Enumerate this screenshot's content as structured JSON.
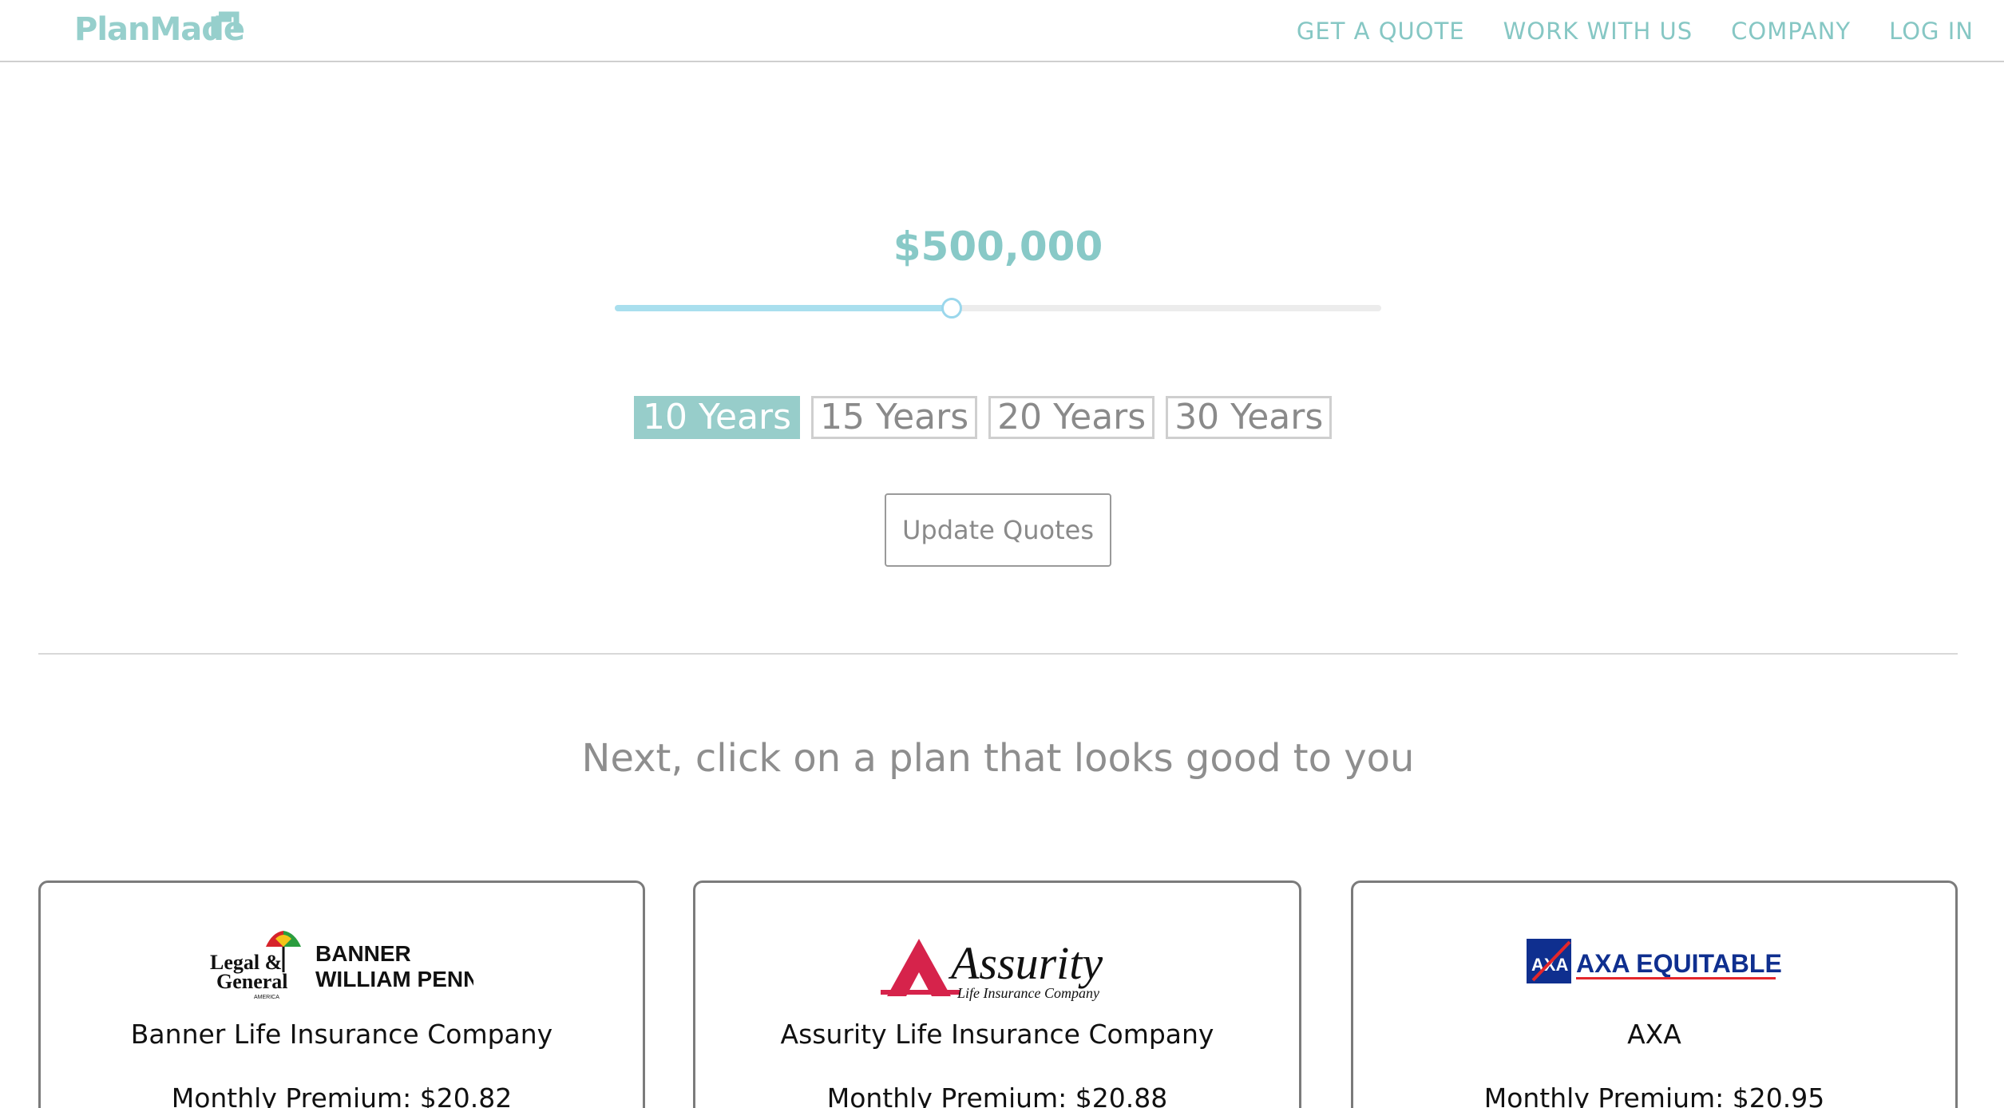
{
  "brand": {
    "name": "PlanMade",
    "color": "#96cfcc"
  },
  "nav": {
    "items": [
      {
        "label": "GET A QUOTE"
      },
      {
        "label": "WORK WITH US"
      },
      {
        "label": "COMPANY"
      },
      {
        "label": "LOG IN"
      }
    ]
  },
  "coverage": {
    "amount": "$500,000",
    "slider_level_fraction": 0.44
  },
  "terms": {
    "options": [
      {
        "label": "10 Years",
        "selected": true
      },
      {
        "label": "15 Years",
        "selected": false
      },
      {
        "label": "20 Years",
        "selected": false
      },
      {
        "label": "30 Years",
        "selected": false
      }
    ]
  },
  "update_button": {
    "label": "Update Quotes"
  },
  "plans_heading": "Next, click on a plan that looks good to you",
  "plans": [
    {
      "logo_icon": "legal-general-banner-logo",
      "logo_text_1": "Legal &",
      "logo_text_2": "General",
      "logo_text_3": "AMERICA",
      "logo_brand_1": "BANNER",
      "logo_brand_2": "WILLIAM PENN",
      "company": "Banner Life Insurance Company",
      "premium": "Monthly Premium: $20.82"
    },
    {
      "logo_icon": "assurity-logo",
      "logo_brand_1": "Assurity",
      "logo_brand_2": "Life Insurance Company",
      "company": "Assurity Life Insurance Company",
      "premium": "Monthly Premium: $20.88"
    },
    {
      "logo_icon": "axa-equitable-logo",
      "logo_mark": "AXA",
      "logo_brand_1": "AXA EQUITABLE",
      "company": "AXA",
      "premium": "Monthly Premium: $20.95"
    }
  ],
  "colors": {
    "accent": "#97cdca",
    "slider_fill": "#a9dfee",
    "text_muted": "#8a8a8a"
  }
}
